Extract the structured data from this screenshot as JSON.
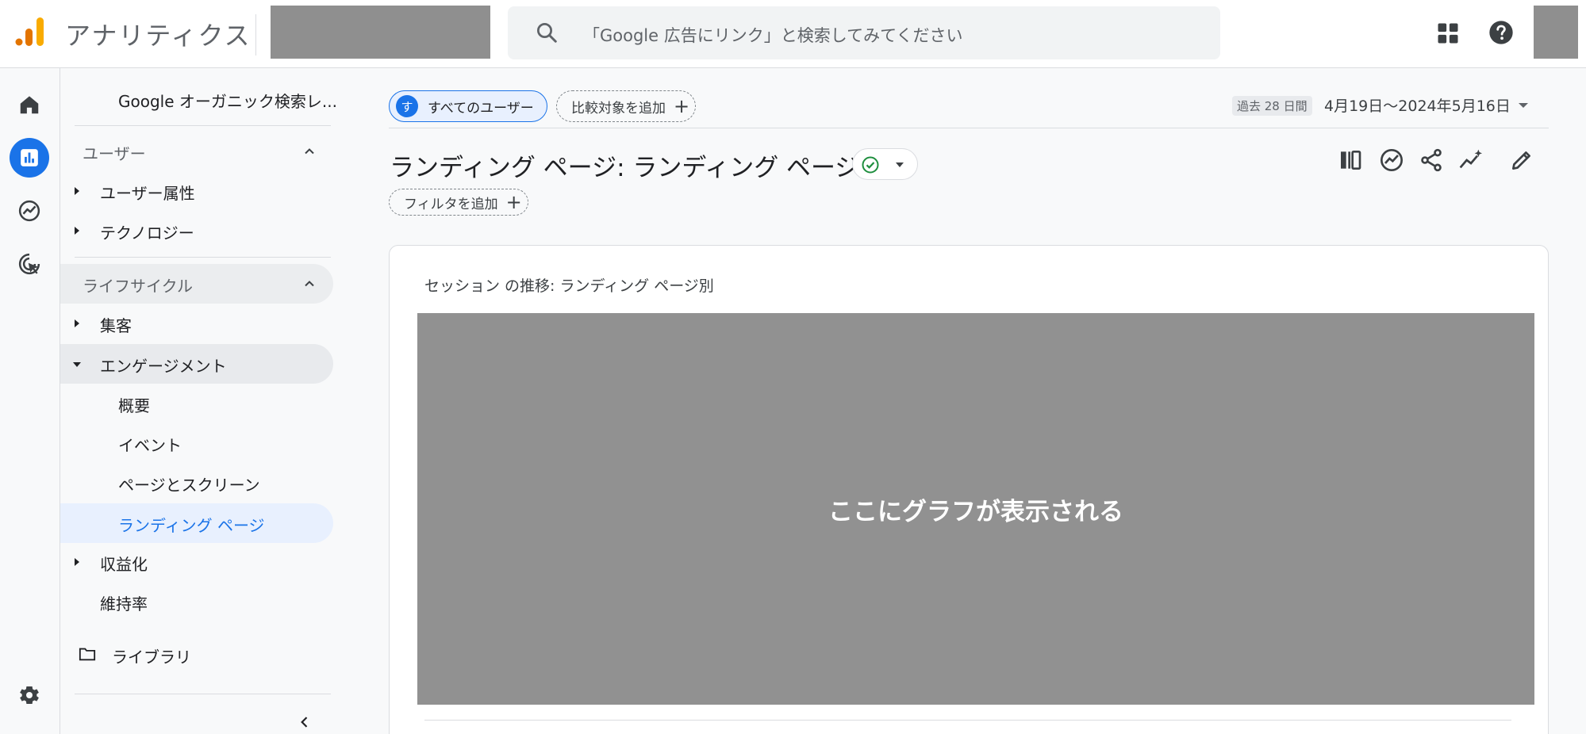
{
  "header": {
    "app_title": "アナリティクス",
    "search_placeholder": "「Google 広告にリンク」と検索してみてください",
    "icons": [
      "analytics-logo-icon",
      "search-icon",
      "apps-grid-icon",
      "help-icon"
    ]
  },
  "rail": {
    "icons": [
      "home-icon",
      "reports-icon",
      "explore-icon",
      "advertising-icon",
      "settings-icon"
    ],
    "active": "reports-icon"
  },
  "sidebar": {
    "collection_title": "Google オーガニック検索レ...",
    "user_section": "ユーザー",
    "user_items": [
      "ユーザー属性",
      "テクノロジー"
    ],
    "lifecycle_section": "ライフサイクル",
    "acquisition": "集客",
    "engagement": "エンゲージメント",
    "engagement_sub": [
      "概要",
      "イベント",
      "ページとスクリーン",
      "ランディング ページ"
    ],
    "monetization": "収益化",
    "retention": "維持率",
    "library": "ライブラリ"
  },
  "toolbar": {
    "segment_avatar": "す",
    "segment_label": "すべてのユーザー",
    "compare_label": "比較対象を追加",
    "date_badge": "過去 28 日間",
    "date_range": "4月19日～2024年5月16日"
  },
  "page": {
    "title": "ランディング ページ: ランディング ページ",
    "filter_label": "フィルタを追加"
  },
  "card": {
    "title": "セッション の推移: ランディング ページ別",
    "placeholder": "ここにグラフが表示される"
  },
  "colors": {
    "accent": "#1a73e8",
    "selected_bg": "#e8f0fe",
    "logo_orange": "#f9ab00",
    "logo_dark_orange": "#e37400",
    "check_green": "#1e8e3e"
  }
}
